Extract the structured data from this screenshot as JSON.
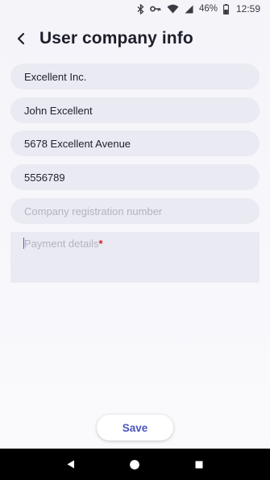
{
  "status_bar": {
    "battery_percent": "46%",
    "time": "12:59",
    "icons": [
      "bluetooth-icon",
      "key-icon",
      "wifi-icon",
      "signal-icon",
      "battery-icon"
    ]
  },
  "header": {
    "title": "User company info",
    "back_icon": "back-arrow-icon"
  },
  "form": {
    "company_name": "Excellent Inc.",
    "contact_name": "John Excellent",
    "address": "5678 Excellent Avenue",
    "phone": "5556789",
    "registration_placeholder": "Company registration number",
    "payment_placeholder": "Payment details",
    "payment_required_mark": "*"
  },
  "actions": {
    "save_label": "Save"
  },
  "nav_bar": {
    "icons": [
      "nav-back-icon",
      "nav-home-icon",
      "nav-recents-icon"
    ]
  },
  "colors": {
    "accent": "#4b56bf",
    "field_bg": "#eaeaf2",
    "required": "#d21f2e"
  }
}
